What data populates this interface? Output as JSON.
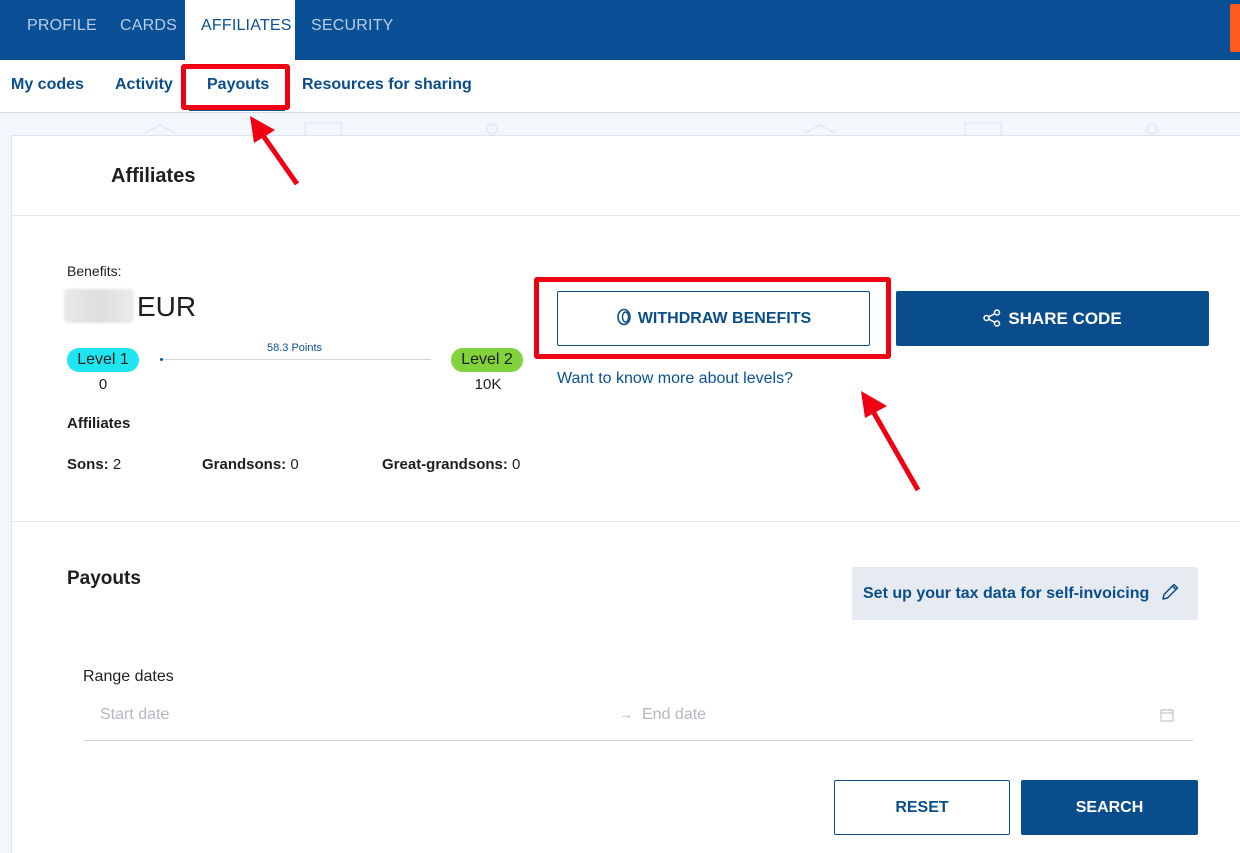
{
  "top_nav": {
    "tabs": [
      {
        "label": "PROFILE"
      },
      {
        "label": "CARDS"
      },
      {
        "label": "AFFILIATES",
        "active": true
      },
      {
        "label": "SECURITY"
      }
    ]
  },
  "sub_nav": {
    "items": [
      {
        "label": "My codes"
      },
      {
        "label": "Activity"
      },
      {
        "label": "Payouts",
        "active": true
      },
      {
        "label": "Resources for sharing"
      }
    ]
  },
  "affiliates_card": {
    "title": "Affiliates",
    "benefits_label": "Benefits:",
    "currency": "EUR",
    "level_from": {
      "name": "Level 1",
      "value": "0"
    },
    "level_to": {
      "name": "Level 2",
      "value": "10K"
    },
    "points_label": "58.3 Points",
    "progress_fraction": 0.0058,
    "withdraw_label": "WITHDRAW BENEFITS",
    "share_label": "SHARE CODE",
    "levels_link": "Want to know more about levels?",
    "affiliates_heading": "Affiliates",
    "stats": [
      {
        "label": "Sons:",
        "value": "2"
      },
      {
        "label": "Grandsons:",
        "value": "0"
      },
      {
        "label": "Great-grandsons:",
        "value": "0"
      }
    ]
  },
  "payouts": {
    "title": "Payouts",
    "tax_button": "Set up your tax data for self-invoicing",
    "range_label": "Range dates",
    "start_placeholder": "Start date",
    "end_placeholder": "End date",
    "reset_label": "RESET",
    "search_label": "SEARCH"
  },
  "colors": {
    "brand_blue": "#0a4d8c",
    "nav_blue": "#0a5096",
    "level1": "#1ee6f0",
    "level2": "#82d23c",
    "highlight_red": "#f00012"
  }
}
